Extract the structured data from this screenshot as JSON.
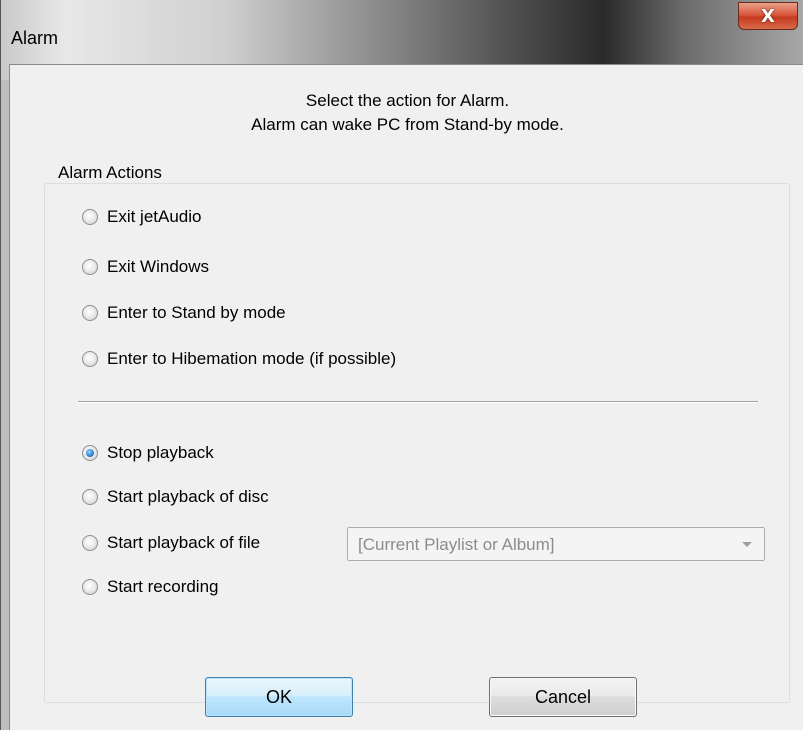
{
  "window": {
    "title": "Alarm",
    "close_label": "X"
  },
  "description": {
    "line1": "Select the action for Alarm.",
    "line2": "Alarm can wake PC from Stand-by mode."
  },
  "group": {
    "label": "Alarm Actions",
    "system_actions": [
      {
        "label": "Exit jetAudio",
        "checked": false
      },
      {
        "label": "Exit Windows",
        "checked": false
      },
      {
        "label": "Enter to Stand by mode",
        "checked": false
      },
      {
        "label": "Enter to Hibemation mode (if possible)",
        "checked": false
      }
    ],
    "playback_actions": [
      {
        "label": "Stop playback",
        "checked": true
      },
      {
        "label": "Start playback of disc",
        "checked": false
      },
      {
        "label": "Start playback of file",
        "checked": false
      },
      {
        "label": "Start recording",
        "checked": false
      }
    ],
    "file_combo": {
      "value": "[Current Playlist or Album]",
      "enabled": false
    }
  },
  "buttons": {
    "ok_label": "OK",
    "cancel_label": "Cancel"
  },
  "colors": {
    "accent": "#3c7fb1",
    "close": "#c53b1f"
  }
}
